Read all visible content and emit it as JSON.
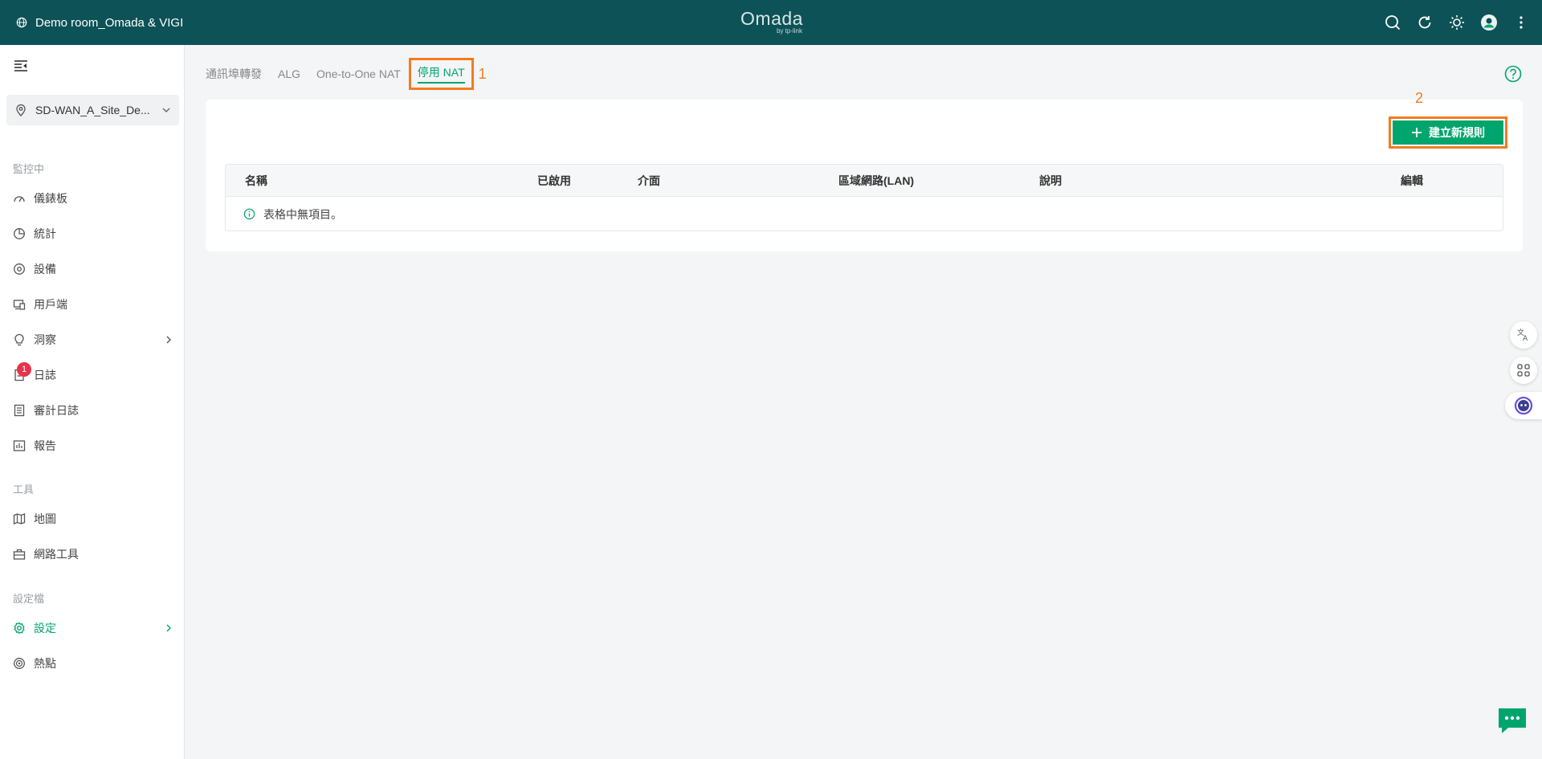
{
  "header": {
    "room_name": "Demo room_Omada & VIGI",
    "logo_text": "Omada",
    "logo_sub": "by tp-link"
  },
  "sidebar": {
    "site_name": "SD-WAN_A_Site_De...",
    "sections": {
      "monitoring": "監控中",
      "tools": "工具",
      "profiles": "設定檔"
    },
    "items": [
      {
        "label": "儀錶板",
        "icon": "dashboard-icon"
      },
      {
        "label": "統計",
        "icon": "pie-chart-icon"
      },
      {
        "label": "設備",
        "icon": "device-icon"
      },
      {
        "label": "用戶端",
        "icon": "client-icon"
      },
      {
        "label": "洞察",
        "icon": "bulb-icon"
      },
      {
        "label": "日誌",
        "icon": "log-icon",
        "badge": "1"
      },
      {
        "label": "審計日誌",
        "icon": "audit-log-icon"
      },
      {
        "label": "報告",
        "icon": "report-icon"
      },
      {
        "label": "地圖",
        "icon": "map-icon"
      },
      {
        "label": "網路工具",
        "icon": "toolbox-icon"
      },
      {
        "label": "設定",
        "icon": "gear-icon"
      },
      {
        "label": "熱點",
        "icon": "hotspot-icon"
      }
    ]
  },
  "tabs": [
    "通訊埠轉發",
    "ALG",
    "One-to-One NAT",
    "停用 NAT"
  ],
  "annotations": [
    "1",
    "2"
  ],
  "create_button": "建立新規則",
  "table": {
    "columns": [
      "名稱",
      "已啟用",
      "介面",
      "區域網路(LAN)",
      "說明",
      "編輯"
    ],
    "empty_text": "表格中無項目。"
  },
  "colors": {
    "header_bg": "#0d5257",
    "accent": "#00a56d",
    "highlight": "#f47b20",
    "badge": "#e8334a"
  }
}
